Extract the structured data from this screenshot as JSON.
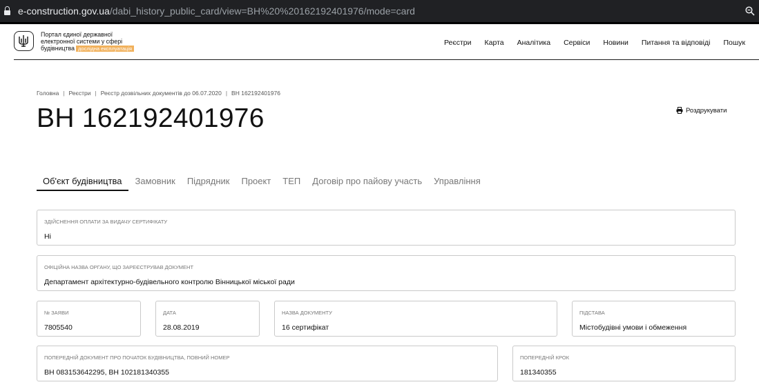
{
  "browser": {
    "url_host": "e-construction.gov.ua",
    "url_path": "/dabi_history_public_card/view=BH%20%20162192401976/mode=card"
  },
  "header": {
    "portal_line1": "Портал єдиної державної",
    "portal_line2": "електронної системи у сфері",
    "portal_line3": "будівництва",
    "beta_badge": "дослідна експлуатація",
    "nav": [
      "Реєстри",
      "Карта",
      "Аналітика",
      "Сервіси",
      "Новини",
      "Питання та відповіді",
      "Пошук"
    ]
  },
  "breadcrumb": [
    "Головна",
    "Реєстри",
    "Реєстр дозвільних документів до 06.07.2020",
    "ВН 162192401976"
  ],
  "page_title": "ВН 162192401976",
  "print_label": "Роздрукувати",
  "tabs": [
    "Об'єкт будівництва",
    "Замовник",
    "Підрядник",
    "Проект",
    "ТЕП",
    "Договір про пайову участь",
    "Управління"
  ],
  "fields": {
    "payment": {
      "label": "Здійснення оплати за видачу сертифікату",
      "value": "Ні"
    },
    "authority": {
      "label": "Офіційна назва органу, що зареєстрував документ",
      "value": "Департамент архітектурно-будівельного контролю Вінницької міської ради"
    },
    "app_no": {
      "label": "№ заяви",
      "value": "7805540"
    },
    "date": {
      "label": "Дата",
      "value": "28.08.2019"
    },
    "doc_name": {
      "label": "Назва документу",
      "value": "16 сертифікат"
    },
    "basis": {
      "label": "Підстава",
      "value": "Містобудівні умови і обмеження"
    },
    "prev_doc": {
      "label": "Попередній документ про початок будівництва, повний номер",
      "value": "ВН 083153642295, ВН 102181340355"
    },
    "prev_step": {
      "label": "Попередній крок",
      "value": "181340355"
    }
  }
}
